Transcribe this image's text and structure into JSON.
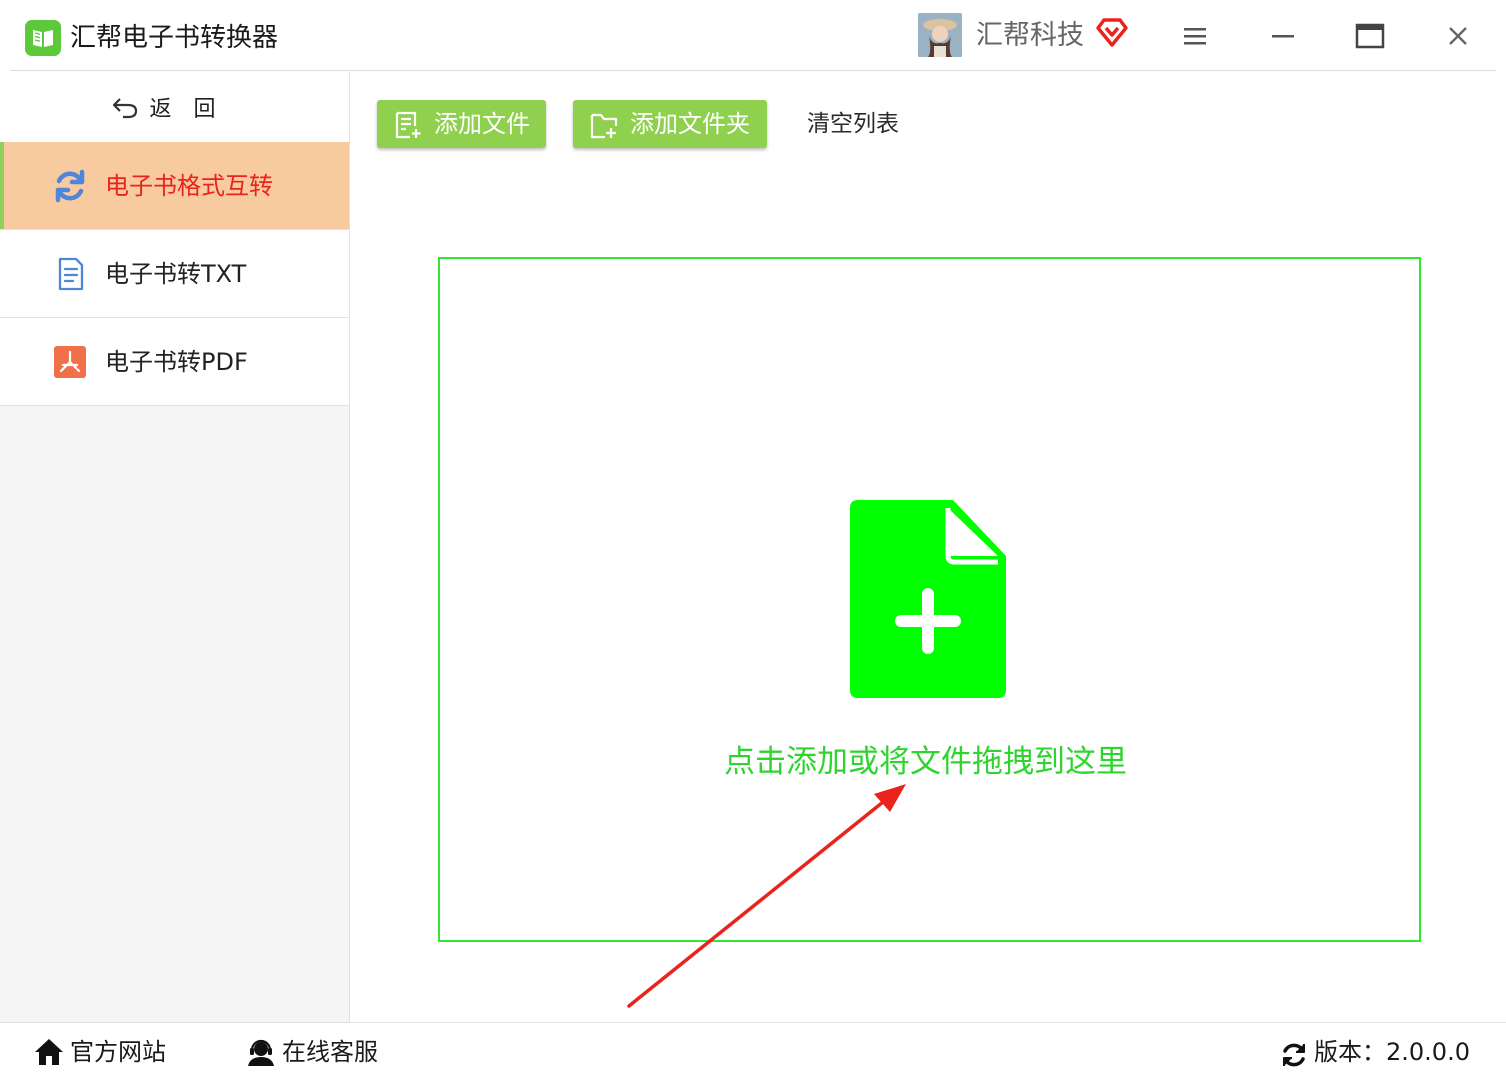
{
  "app": {
    "title": "汇帮电子书转换器",
    "logo_icon": "book-icon",
    "accent_color": "#8fd14f"
  },
  "header": {
    "avatar_icon": "user-avatar",
    "company_name": "汇帮科技",
    "vip_icon": "diamond-icon",
    "vip_color": "#e8241c",
    "window_controls": [
      "menu-icon",
      "minimize-icon",
      "maximize-icon",
      "close-icon"
    ]
  },
  "sidebar": {
    "back_label": "返回",
    "back_icon": "undo-arrow-icon",
    "items": [
      {
        "label": "电子书格式互转",
        "icon": "refresh-icon",
        "active": true,
        "icon_color": "#4f86d9"
      },
      {
        "label": "电子书转TXT",
        "icon": "document-icon",
        "active": false,
        "icon_color": "#4f86d9"
      },
      {
        "label": "电子书转PDF",
        "icon": "pdf-icon",
        "active": false,
        "icon_color": "#f0704a"
      }
    ],
    "active_bg": "#f8caa0",
    "active_text_color": "#e8241c"
  },
  "toolbar": {
    "add_file_label": "添加文件",
    "add_file_icon": "file-add-icon",
    "add_folder_label": "添加文件夹",
    "add_folder_icon": "folder-add-icon",
    "clear_label": "清空列表"
  },
  "dropzone": {
    "icon": "file-plus-icon",
    "prompt": "点击添加或将文件拖拽到这里",
    "border_color": "#33e633",
    "icon_color": "#00ff00",
    "annotation": "red-arrow"
  },
  "footer": {
    "website_label": "官方网站",
    "website_icon": "home-icon",
    "support_label": "在线客服",
    "support_icon": "headset-user-icon",
    "version_label": "版本：2.0.0.0",
    "version_icon": "refresh-icon"
  }
}
